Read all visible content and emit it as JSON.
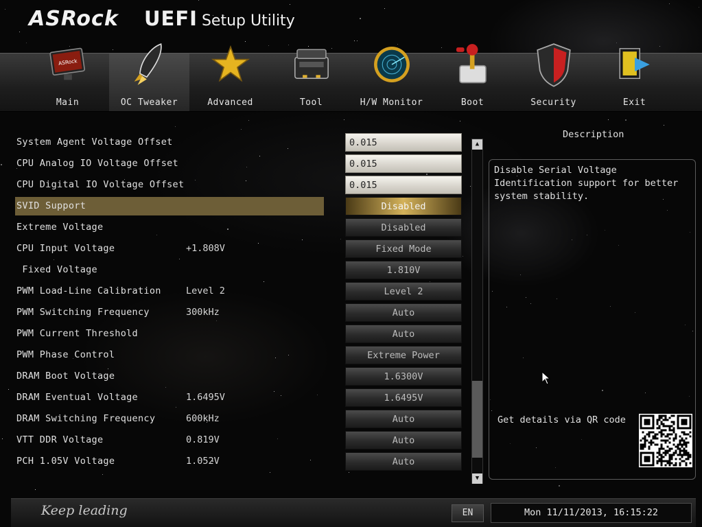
{
  "header": {
    "brand": "ASRock",
    "product": "UEFI",
    "product_sub": "Setup Utility"
  },
  "nav": {
    "active": "OC Tweaker",
    "items": [
      {
        "label": "Main",
        "icon": "monitor-icon"
      },
      {
        "label": "OC Tweaker",
        "icon": "rocket-icon"
      },
      {
        "label": "Advanced",
        "icon": "star-icon"
      },
      {
        "label": "Tool",
        "icon": "toolbox-icon"
      },
      {
        "label": "H/W Monitor",
        "icon": "radar-icon"
      },
      {
        "label": "Boot",
        "icon": "joystick-icon"
      },
      {
        "label": "Security",
        "icon": "shield-icon"
      },
      {
        "label": "Exit",
        "icon": "exit-door-icon"
      }
    ]
  },
  "settings": [
    {
      "label": "System Agent Voltage Offset",
      "current": "",
      "value": "0.015",
      "kind": "input"
    },
    {
      "label": "CPU Analog IO Voltage Offset",
      "current": "",
      "value": "0.015",
      "kind": "input"
    },
    {
      "label": "CPU Digital IO Voltage Offset",
      "current": "",
      "value": "0.015",
      "kind": "input"
    },
    {
      "label": "SVID Support",
      "current": "",
      "value": "Disabled",
      "kind": "select",
      "selected": true
    },
    {
      "label": "Extreme Voltage",
      "current": "",
      "value": "Disabled",
      "kind": "select"
    },
    {
      "label": "CPU Input Voltage",
      "current": "+1.808V",
      "value": "Fixed Mode",
      "kind": "select"
    },
    {
      "label": " Fixed Voltage",
      "current": "",
      "value": "1.810V",
      "kind": "select"
    },
    {
      "label": "PWM Load-Line Calibration",
      "current": "Level 2",
      "value": "Level 2",
      "kind": "select"
    },
    {
      "label": "PWM Switching Frequency",
      "current": "300kHz",
      "value": "Auto",
      "kind": "select"
    },
    {
      "label": "PWM Current Threshold",
      "current": "",
      "value": "Auto",
      "kind": "select"
    },
    {
      "label": "PWM Phase Control",
      "current": "",
      "value": "Extreme Power",
      "kind": "select"
    },
    {
      "label": "DRAM Boot Voltage",
      "current": "",
      "value": "1.6300V",
      "kind": "select"
    },
    {
      "label": "DRAM Eventual Voltage",
      "current": "1.6495V",
      "value": "1.6495V",
      "kind": "select"
    },
    {
      "label": "DRAM Switching Frequency",
      "current": "600kHz",
      "value": "Auto",
      "kind": "select"
    },
    {
      "label": "VTT DDR Voltage",
      "current": "0.819V",
      "value": "Auto",
      "kind": "select"
    },
    {
      "label": "PCH 1.05V Voltage",
      "current": "1.052V",
      "value": "Auto",
      "kind": "select"
    }
  ],
  "scrollbar": {
    "up_icon": "arrow-up-icon",
    "down_icon": "arrow-down-icon"
  },
  "description": {
    "title": "Description",
    "text": "Disable Serial Voltage Identification support for better system stability.",
    "qr_label": "Get details via QR code"
  },
  "footer": {
    "tagline": "Keep leading",
    "language": "EN",
    "datetime": "Mon 11/11/2013, 16:15:22"
  },
  "colors": {
    "selected_row": "#6d5e37",
    "active_value": "#d4b25a",
    "background": "#070707"
  }
}
